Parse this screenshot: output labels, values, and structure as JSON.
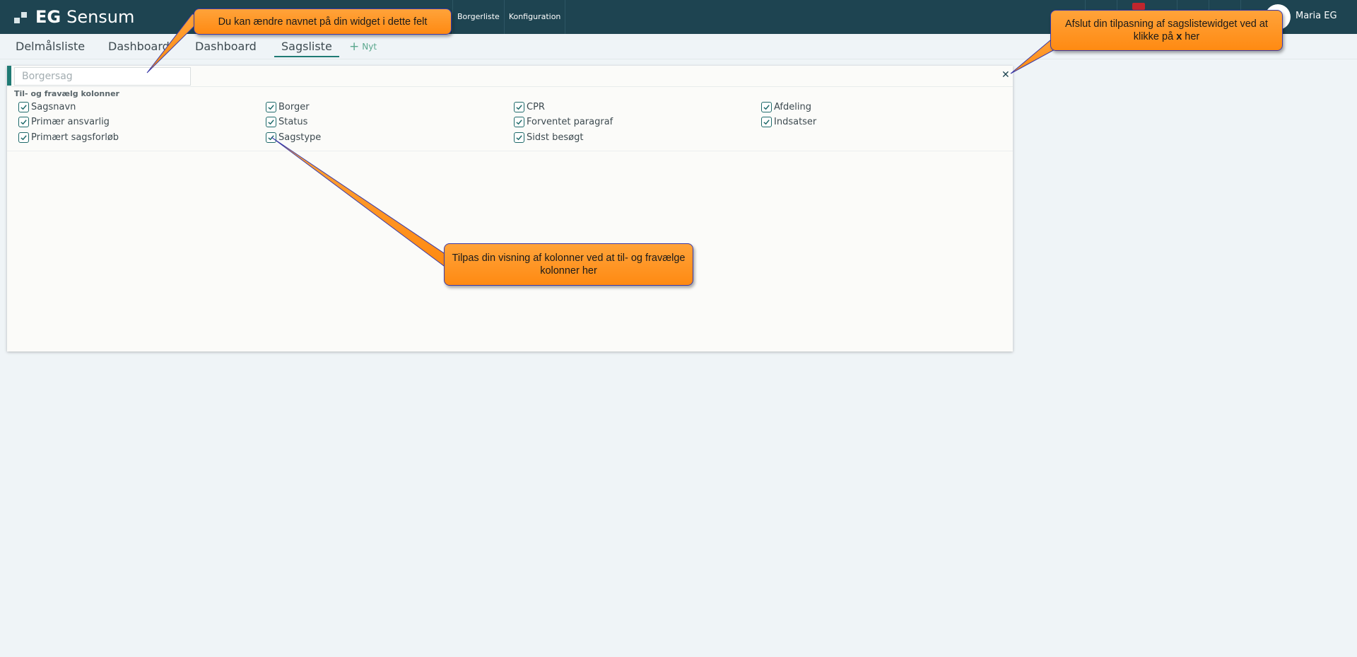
{
  "app": {
    "logo_bold": "EG",
    "logo_name": "Sensum"
  },
  "nav": {
    "items": [
      "Borgerliste",
      "Konfiguration"
    ]
  },
  "user": {
    "name": "Maria EG"
  },
  "tabs": [
    {
      "label": "Delmålsliste"
    },
    {
      "label": "Dashboard"
    },
    {
      "label": "Dashboard"
    },
    {
      "label": "Sagsliste"
    }
  ],
  "new_tab_label": "Nyt",
  "widget": {
    "name_placeholder": "Borgersag",
    "close_label": "✕",
    "columns_heading": "Til- og fravælg kolonner",
    "columns": [
      {
        "label": "Sagsnavn",
        "checked": true
      },
      {
        "label": "Borger",
        "checked": true
      },
      {
        "label": "CPR",
        "checked": true
      },
      {
        "label": "Afdeling",
        "checked": true
      },
      {
        "label": "Primær ansvarlig",
        "checked": true
      },
      {
        "label": "Status",
        "checked": true
      },
      {
        "label": "Forventet paragraf",
        "checked": true
      },
      {
        "label": "Indsatser",
        "checked": true
      },
      {
        "label": "Primært sagsforløb",
        "checked": true
      },
      {
        "label": "Sagstype",
        "checked": true
      },
      {
        "label": "Sidst besøgt",
        "checked": true
      }
    ]
  },
  "callouts": {
    "rename": "Du kan ændre navnet på din widget i dette felt",
    "close_prefix": "Afslut din tilpasning af sagslistewidget ved at klikke på ",
    "close_key": "x",
    "close_suffix": " her",
    "columns": "Tilpas din visning af kolonner ved at til- og fravælge kolonner her"
  },
  "colors": {
    "topbar": "#1e4451",
    "accent": "#1f7a74",
    "callout": "#ff9a26",
    "callout_border": "#3a3aa8"
  }
}
